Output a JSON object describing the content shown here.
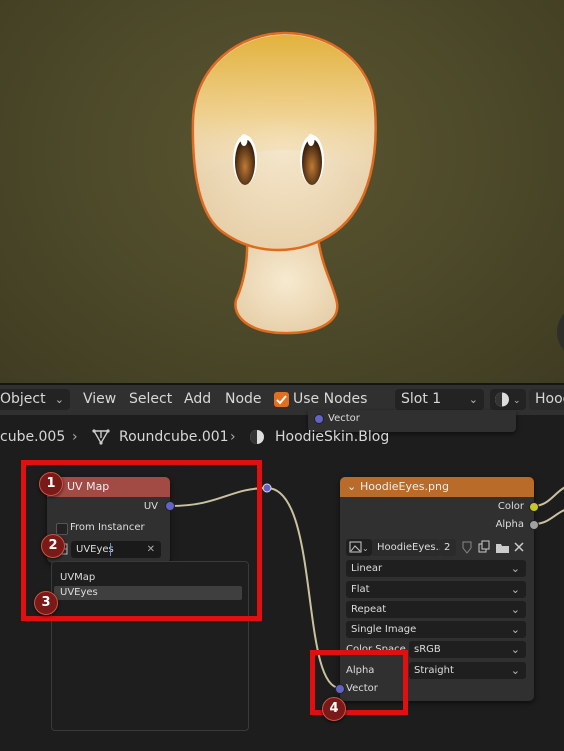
{
  "header": {
    "mode": "Object",
    "menu": [
      "View",
      "Select",
      "Add",
      "Node"
    ],
    "use_nodes_label": "Use Nodes",
    "use_nodes_checked": true,
    "slot": "Slot 1",
    "material_field": "Hood",
    "tooltip_vector": "Vector"
  },
  "breadcrumb": {
    "object": "cube.005",
    "mesh": "Roundcube.001",
    "material": "HoodieSkin.Blog"
  },
  "uvmap_node": {
    "title": "UV Map",
    "output_uv": "UV",
    "from_instancer": "From Instancer",
    "uv_value": "UVEyes"
  },
  "uv_popup": {
    "items": [
      "UVMap",
      "UVEyes"
    ],
    "selected": "UVEyes"
  },
  "image_node": {
    "title": "HoodieEyes.png",
    "output_color": "Color",
    "output_alpha": "Alpha",
    "image_name": "HoodieEyes...",
    "users": "2",
    "interpolation": "Linear",
    "projection": "Flat",
    "extension": "Repeat",
    "source": "Single Image",
    "color_space_label": "Color Space",
    "color_space": "sRGB",
    "alpha_label": "Alpha",
    "alpha_mode": "Straight",
    "input_vector": "Vector"
  },
  "badges": [
    "1",
    "2",
    "3",
    "4"
  ],
  "colors": {
    "node_header_uv": "#a24b45",
    "node_header_texture": "#b96b2a",
    "annotation_red": "#e01010",
    "socket_vector": "#6363c7",
    "socket_color": "#c7c729",
    "socket_alpha": "#a1a1a1",
    "checkbox_orange": "#e07020"
  }
}
